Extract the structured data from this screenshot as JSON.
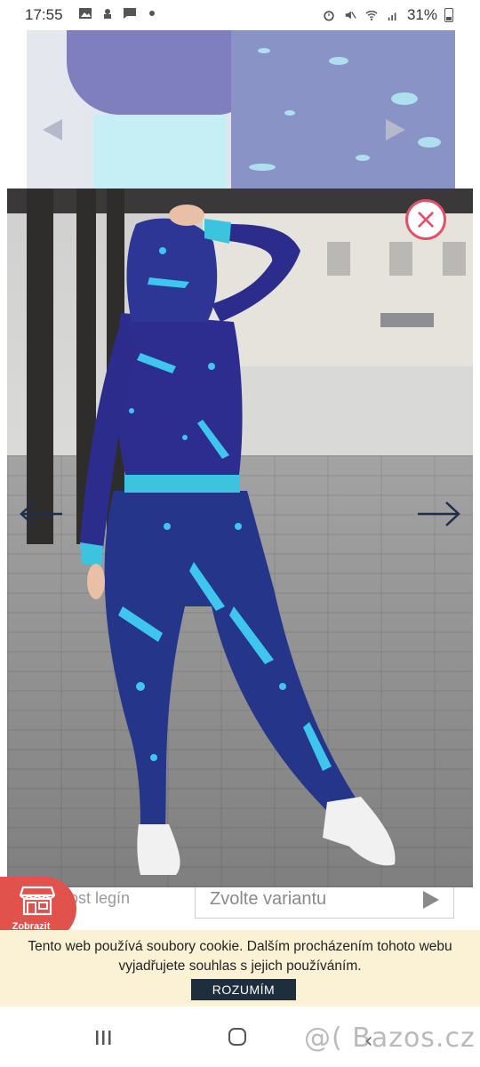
{
  "status_bar": {
    "time": "17:55",
    "battery": "31%",
    "left_icons": [
      "image-icon",
      "app-icon",
      "chat-icon",
      "dot-icon"
    ],
    "right_icons": [
      "alarm-icon",
      "mute-icon",
      "wifi-icon",
      "signal-icon",
      "battery-icon"
    ]
  },
  "lightbox": {
    "close_icon": "close-icon",
    "prev_icon": "arrow-left-icon",
    "next_icon": "arrow-right-icon",
    "accent": "#e2516a"
  },
  "product": {
    "variant_label": "ost legín",
    "variant_placeholder": "Zvolte variantu"
  },
  "show_button": {
    "label": "Zobrazit",
    "icon": "store-icon",
    "color": "#e1524d"
  },
  "cookie": {
    "text": "Tento web používá soubory cookie. Dalším procházením tohoto webu vyjadřujete souhlas s jejich používáním.",
    "button": "ROZUMÍM",
    "background": "#fbf1d4",
    "button_color": "#1f2e3d"
  },
  "system_nav": {
    "recent_icon": "recent-apps-icon",
    "home_icon": "home-icon",
    "back_icon": "back-icon"
  },
  "watermark": "@( Bazos.cz"
}
